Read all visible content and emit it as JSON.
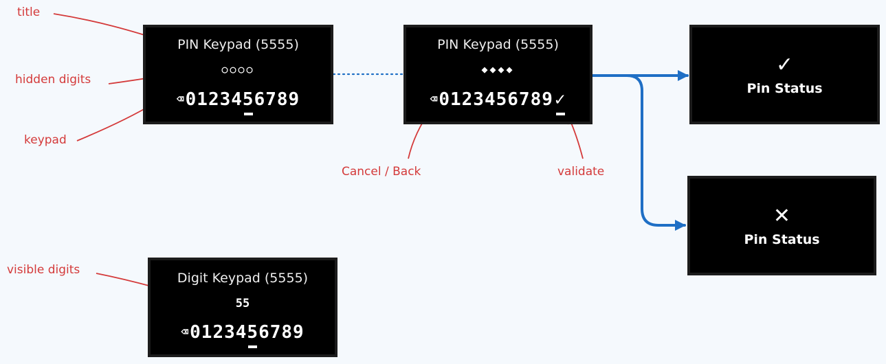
{
  "annotations": {
    "title": "title",
    "hidden_digits": "hidden digits",
    "keypad": "keypad",
    "cancel_back": "Cancel / Back",
    "validate": "validate",
    "visible_digits": "visible digits"
  },
  "screens": {
    "pin_left": {
      "title": "PIN Keypad (5555)",
      "digits": "○○○○",
      "keys": [
        "⌫",
        "0",
        "1",
        "2",
        "3",
        "4",
        "5",
        "6",
        "7",
        "8",
        "9"
      ],
      "selected_key": "5"
    },
    "pin_middle": {
      "title": "PIN Keypad (5555)",
      "digits": "◆◆◆◆",
      "keys": [
        "⌫",
        "0",
        "1",
        "2",
        "3",
        "4",
        "5",
        "6",
        "7",
        "8",
        "9",
        "✓"
      ],
      "selected_key": "✓"
    },
    "status_success": {
      "icon": "✓",
      "icon_name": "check-icon",
      "label": "Pin Status"
    },
    "status_fail": {
      "icon": "✕",
      "icon_name": "cross-icon",
      "label": "Pin Status"
    },
    "digit_keypad": {
      "title": "Digit Keypad (5555)",
      "digits": "55",
      "keys": [
        "⌫",
        "0",
        "1",
        "2",
        "3",
        "4",
        "5",
        "6",
        "7",
        "8",
        "9"
      ],
      "selected_key": "5"
    }
  },
  "colors": {
    "annotation": "#d43a3a",
    "flow_arrow": "#1f6fc5",
    "dotted_link": "#1f6fc5",
    "screen_bg": "#000000",
    "screen_border": "#1c1c1c",
    "page_bg": "#f5f9fd"
  }
}
